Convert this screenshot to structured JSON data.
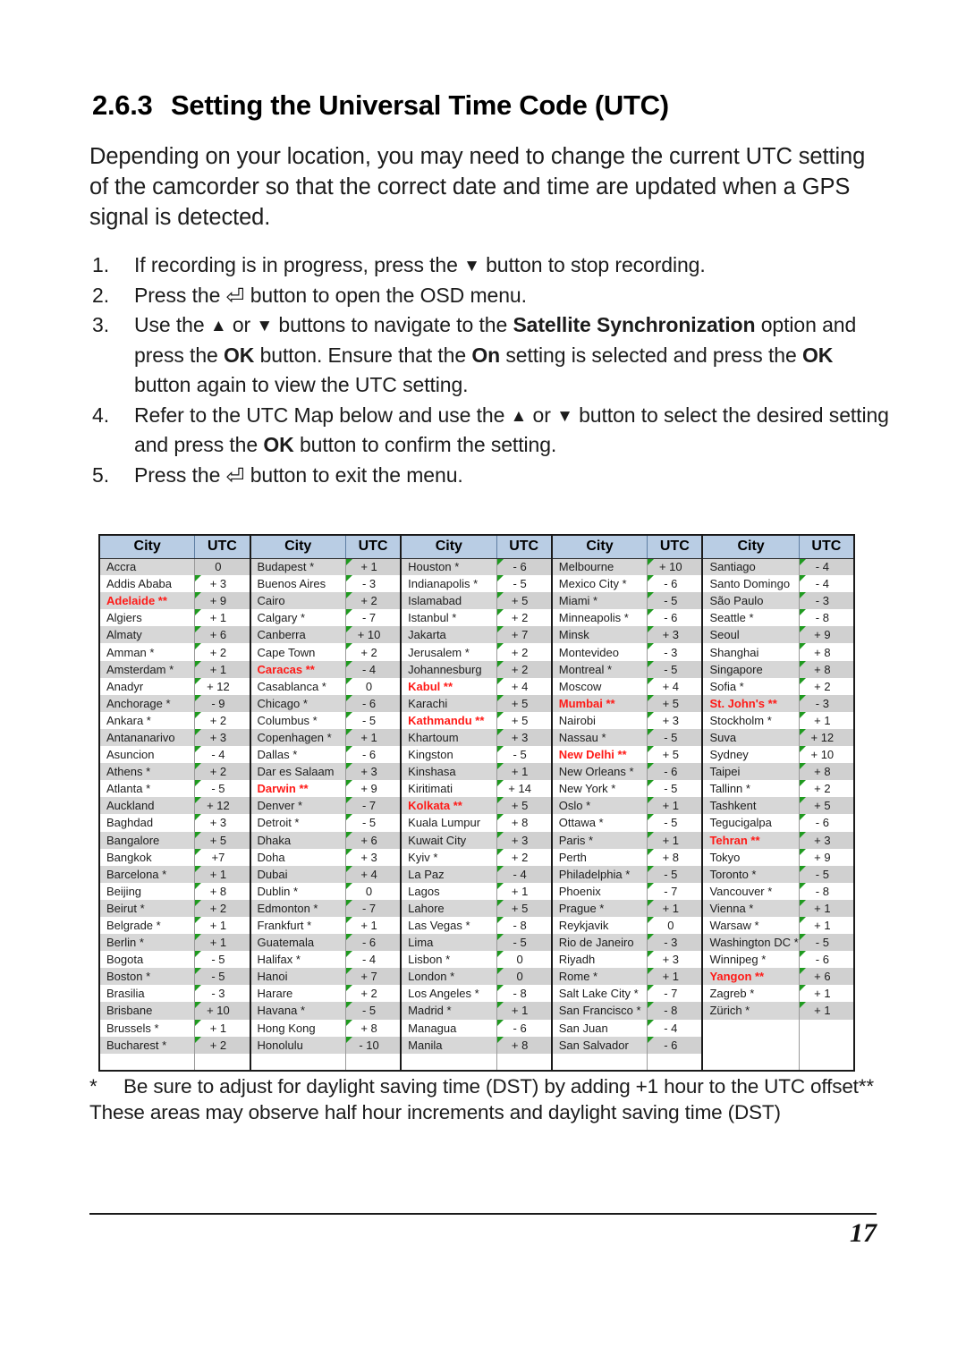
{
  "heading": {
    "number": "2.6.3",
    "title": "Setting the Universal Time Code (UTC)"
  },
  "intro": "Depending on your location, you may need to change the current UTC setting of the camcorder so that the correct date and time are updated when a GPS signal is detected.",
  "steps": [
    {
      "no": "1.",
      "parts": [
        {
          "t": "text",
          "v": "If recording is in progress, press the "
        },
        {
          "t": "icon",
          "v": "▼",
          "name": "down-arrow-icon"
        },
        {
          "t": "text",
          "v": " button to stop recording."
        }
      ]
    },
    {
      "no": "2.",
      "parts": [
        {
          "t": "text",
          "v": "Press the "
        },
        {
          "t": "icon",
          "v": "⏎",
          "name": "return-arrow-icon"
        },
        {
          "t": "text",
          "v": " button to open the OSD menu."
        }
      ]
    },
    {
      "no": "3.",
      "parts": [
        {
          "t": "text",
          "v": "Use the "
        },
        {
          "t": "icon",
          "v": "▲",
          "name": "up-arrow-icon"
        },
        {
          "t": "text",
          "v": " or "
        },
        {
          "t": "icon",
          "v": "▼",
          "name": "down-arrow-icon"
        },
        {
          "t": "text",
          "v": " buttons to navigate to the "
        },
        {
          "t": "bold",
          "v": "Satellite Synchronization"
        },
        {
          "t": "text",
          "v": " option and press the "
        },
        {
          "t": "bold",
          "v": "OK"
        },
        {
          "t": "text",
          "v": " button. Ensure that the "
        },
        {
          "t": "bold",
          "v": "On"
        },
        {
          "t": "text",
          "v": " setting is selected and press the "
        },
        {
          "t": "bold",
          "v": "OK"
        },
        {
          "t": "text",
          "v": " button again to view the UTC setting."
        }
      ]
    },
    {
      "no": "4.",
      "parts": [
        {
          "t": "text",
          "v": "Refer to the UTC Map below and use the "
        },
        {
          "t": "icon",
          "v": "▲",
          "name": "up-arrow-icon"
        },
        {
          "t": "text",
          "v": " or "
        },
        {
          "t": "icon",
          "v": "▼",
          "name": "down-arrow-icon"
        },
        {
          "t": "text",
          "v": " button to select the desired setting and press the "
        },
        {
          "t": "bold",
          "v": "OK"
        },
        {
          "t": "text",
          "v": " button to confirm the setting."
        }
      ]
    },
    {
      "no": "5.",
      "parts": [
        {
          "t": "text",
          "v": "Press the "
        },
        {
          "t": "icon",
          "v": "⏎",
          "name": "return-arrow-icon"
        },
        {
          "t": "text",
          "v": " button to exit the menu."
        }
      ]
    }
  ],
  "table": {
    "headers": [
      "City",
      "UTC",
      "City",
      "UTC",
      "City",
      "UTC",
      "City",
      "UTC",
      "City",
      "UTC"
    ],
    "colors": {
      "header_bg": "#b9cde4",
      "alt_row_bg": "#d7d7d7",
      "highlight_text": "#ff1a17",
      "marker": "#1f9a1f"
    },
    "columns": [
      [
        [
          "Accra",
          "0",
          false
        ],
        [
          "Addis Ababa",
          "+ 3",
          false
        ],
        [
          "Adelaide **",
          "+ 9",
          true
        ],
        [
          "Algiers",
          "+ 1",
          false
        ],
        [
          "Almaty",
          "+ 6",
          false
        ],
        [
          "Amman *",
          "+ 2",
          false
        ],
        [
          "Amsterdam *",
          "+ 1",
          false
        ],
        [
          "Anadyr",
          "+ 12",
          false
        ],
        [
          "Anchorage *",
          "- 9",
          false
        ],
        [
          "Ankara *",
          "+ 2",
          false
        ],
        [
          "Antananarivo",
          "+ 3",
          false
        ],
        [
          "Asuncion",
          "- 4",
          false
        ],
        [
          "Athens *",
          "+ 2",
          false
        ],
        [
          "Atlanta *",
          "- 5",
          false
        ],
        [
          "Auckland",
          "+ 12",
          false
        ],
        [
          "Baghdad",
          "+ 3",
          false
        ],
        [
          "Bangalore",
          "+ 5",
          false
        ],
        [
          "Bangkok",
          "+7",
          false
        ],
        [
          "Barcelona *",
          "+ 1",
          false
        ],
        [
          "Beijing",
          "+ 8",
          false
        ],
        [
          "Beirut *",
          "+ 2",
          false
        ],
        [
          "Belgrade *",
          "+ 1",
          false
        ],
        [
          "Berlin *",
          "+ 1",
          false
        ],
        [
          "Bogota",
          "- 5",
          false
        ],
        [
          "Boston *",
          "- 5",
          false
        ],
        [
          "Brasilia",
          "- 3",
          false
        ],
        [
          "Brisbane",
          "+ 10",
          false
        ],
        [
          "Brussels *",
          "+ 1",
          false
        ],
        [
          "Bucharest *",
          "+ 2",
          false
        ],
        [
          "",
          "",
          false
        ]
      ],
      [
        [
          "Budapest *",
          "+ 1",
          false
        ],
        [
          "Buenos Aires",
          "- 3",
          false
        ],
        [
          "Cairo",
          "+ 2",
          false
        ],
        [
          "Calgary *",
          "- 7",
          false
        ],
        [
          "Canberra",
          "+ 10",
          false
        ],
        [
          "Cape Town",
          "+ 2",
          false
        ],
        [
          "Caracas **",
          "- 4",
          true
        ],
        [
          "Casablanca *",
          "0",
          false
        ],
        [
          "Chicago *",
          "- 6",
          false
        ],
        [
          "Columbus *",
          "- 5",
          false
        ],
        [
          "Copenhagen *",
          "+ 1",
          false
        ],
        [
          "Dallas *",
          "- 6",
          false
        ],
        [
          "Dar es Salaam",
          "+ 3",
          false
        ],
        [
          "Darwin **",
          "+ 9",
          true
        ],
        [
          "Denver *",
          "- 7",
          false
        ],
        [
          "Detroit *",
          "- 5",
          false
        ],
        [
          "Dhaka",
          "+ 6",
          false
        ],
        [
          "Doha",
          "+ 3",
          false
        ],
        [
          "Dubai",
          "+ 4",
          false
        ],
        [
          "Dublin *",
          "0",
          false
        ],
        [
          "Edmonton *",
          "- 7",
          false
        ],
        [
          "Frankfurt *",
          "+ 1",
          false
        ],
        [
          "Guatemala",
          "- 6",
          false
        ],
        [
          "Halifax *",
          "- 4",
          false
        ],
        [
          "Hanoi",
          "+ 7",
          false
        ],
        [
          "Harare",
          "+ 2",
          false
        ],
        [
          "Havana *",
          "- 5",
          false
        ],
        [
          "Hong Kong",
          "+ 8",
          false
        ],
        [
          "Honolulu",
          "- 10",
          false
        ],
        [
          "",
          "",
          false
        ]
      ],
      [
        [
          "Houston *",
          "- 6",
          false
        ],
        [
          "Indianapolis *",
          "- 5",
          false
        ],
        [
          "Islamabad",
          "+ 5",
          false
        ],
        [
          "Istanbul *",
          "+ 2",
          false
        ],
        [
          "Jakarta",
          "+ 7",
          false
        ],
        [
          "Jerusalem *",
          "+ 2",
          false
        ],
        [
          "Johannesburg",
          "+ 2",
          false
        ],
        [
          "Kabul **",
          "+ 4",
          true
        ],
        [
          "Karachi",
          "+ 5",
          false
        ],
        [
          "Kathmandu **",
          "+ 5",
          true
        ],
        [
          "Khartoum",
          "+ 3",
          false
        ],
        [
          "Kingston",
          "- 5",
          false
        ],
        [
          "Kinshasa",
          "+ 1",
          false
        ],
        [
          "Kiritimati",
          "+ 14",
          false
        ],
        [
          "Kolkata **",
          "+ 5",
          true
        ],
        [
          "Kuala Lumpur",
          "+ 8",
          false
        ],
        [
          "Kuwait City",
          "+ 3",
          false
        ],
        [
          "Kyiv *",
          "+ 2",
          false
        ],
        [
          "La Paz",
          "- 4",
          false
        ],
        [
          "Lagos",
          "+ 1",
          false
        ],
        [
          "Lahore",
          "+ 5",
          false
        ],
        [
          "Las Vegas *",
          "- 8",
          false
        ],
        [
          "Lima",
          "- 5",
          false
        ],
        [
          "Lisbon *",
          "0",
          false
        ],
        [
          "London *",
          "0",
          false
        ],
        [
          "Los Angeles *",
          "- 8",
          false
        ],
        [
          "Madrid *",
          "+ 1",
          false
        ],
        [
          "Managua",
          "- 6",
          false
        ],
        [
          "Manila",
          "+ 8",
          false
        ],
        [
          "",
          "",
          false
        ]
      ],
      [
        [
          "Melbourne",
          "+ 10",
          false
        ],
        [
          "Mexico City *",
          "- 6",
          false
        ],
        [
          "Miami *",
          "- 5",
          false
        ],
        [
          "Minneapolis *",
          "- 6",
          false
        ],
        [
          "Minsk",
          "+ 3",
          false
        ],
        [
          "Montevideo",
          "- 3",
          false
        ],
        [
          "Montreal *",
          "- 5",
          false
        ],
        [
          "Moscow",
          "+ 4",
          false
        ],
        [
          "Mumbai **",
          "+ 5",
          true
        ],
        [
          "Nairobi",
          "+ 3",
          false
        ],
        [
          "Nassau *",
          "- 5",
          false
        ],
        [
          "New Delhi **",
          "+ 5",
          true
        ],
        [
          "New Orleans *",
          "- 6",
          false
        ],
        [
          "New York *",
          "- 5",
          false
        ],
        [
          "Oslo *",
          "+ 1",
          false
        ],
        [
          "Ottawa *",
          "- 5",
          false
        ],
        [
          "Paris *",
          "+ 1",
          false
        ],
        [
          "Perth",
          "+ 8",
          false
        ],
        [
          "Philadelphia *",
          "- 5",
          false
        ],
        [
          "Phoenix",
          "- 7",
          false
        ],
        [
          "Prague *",
          "+ 1",
          false
        ],
        [
          "Reykjavik",
          "0",
          false
        ],
        [
          "Rio de Janeiro",
          "- 3",
          false
        ],
        [
          "Riyadh",
          "+ 3",
          false
        ],
        [
          "Rome *",
          "+ 1",
          false
        ],
        [
          "Salt Lake City *",
          "- 7",
          false
        ],
        [
          "San Francisco *",
          "- 8",
          false
        ],
        [
          "San Juan",
          "- 4",
          false
        ],
        [
          "San Salvador",
          "- 6",
          false
        ],
        [
          "",
          "",
          false
        ]
      ],
      [
        [
          "Santiago",
          "- 4",
          false
        ],
        [
          "Santo Domingo",
          "- 4",
          false
        ],
        [
          "São Paulo",
          "- 3",
          false
        ],
        [
          "Seattle *",
          "- 8",
          false
        ],
        [
          "Seoul",
          "+ 9",
          false
        ],
        [
          "Shanghai",
          "+ 8",
          false
        ],
        [
          "Singapore",
          "+ 8",
          false
        ],
        [
          "Sofia *",
          "+ 2",
          false
        ],
        [
          "St. John's **",
          "- 3",
          true
        ],
        [
          "Stockholm *",
          "+ 1",
          false
        ],
        [
          "Suva",
          "+ 12",
          false
        ],
        [
          "Sydney",
          "+ 10",
          false
        ],
        [
          "Taipei",
          "+ 8",
          false
        ],
        [
          "Tallinn *",
          "+ 2",
          false
        ],
        [
          "Tashkent",
          "+ 5",
          false
        ],
        [
          "Tegucigalpa",
          "- 6",
          false
        ],
        [
          "Tehran **",
          "+ 3",
          true
        ],
        [
          "Tokyo",
          "+ 9",
          false
        ],
        [
          "Toronto *",
          "- 5",
          false
        ],
        [
          "Vancouver *",
          "- 8",
          false
        ],
        [
          "Vienna *",
          "+ 1",
          false
        ],
        [
          "Warsaw *",
          "+ 1",
          false
        ],
        [
          "Washington DC *",
          "- 5",
          false
        ],
        [
          "Winnipeg *",
          "- 6",
          false
        ],
        [
          "Yangon **",
          "+ 6",
          true
        ],
        [
          "Zagreb *",
          "+ 1",
          false
        ],
        [
          "Zürich *",
          "+ 1",
          false
        ],
        [
          "",
          "",
          false
        ],
        [
          "",
          "",
          false
        ],
        [
          "",
          "",
          false
        ]
      ]
    ]
  },
  "footnote": {
    "marker": "*",
    "text": "Be sure to adjust for daylight saving time (DST) by adding +1 hour to the UTC offset** These areas may observe half hour increments and daylight saving time (DST)"
  },
  "footer": {
    "page_number": "17"
  }
}
